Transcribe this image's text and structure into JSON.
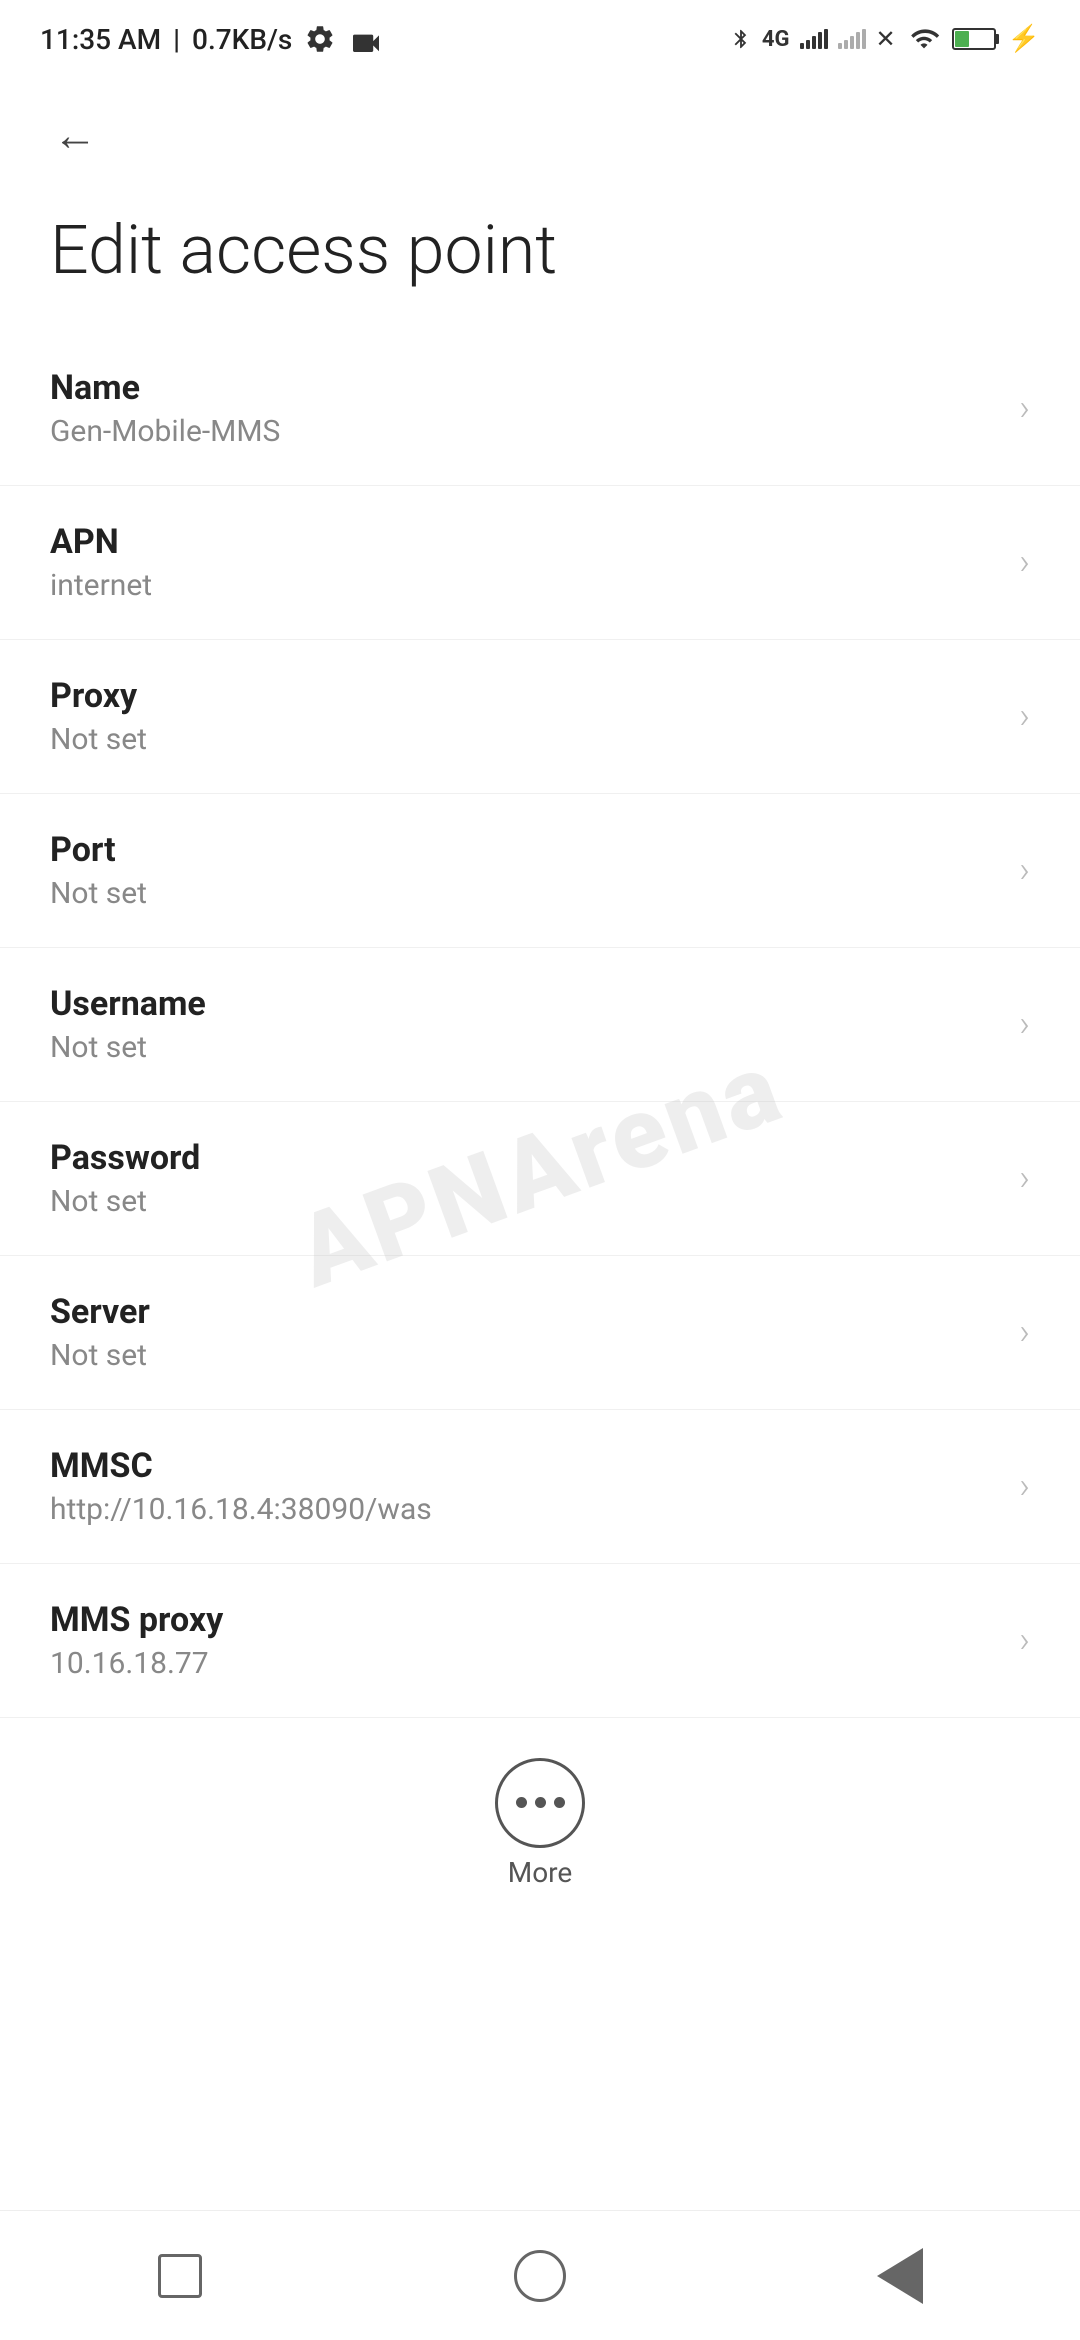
{
  "statusBar": {
    "time": "11:35 AM",
    "speed": "0.7KB/s",
    "battery": "38"
  },
  "toolbar": {
    "backLabel": "←"
  },
  "page": {
    "title": "Edit access point"
  },
  "settings": [
    {
      "id": "name",
      "label": "Name",
      "value": "Gen-Mobile-MMS"
    },
    {
      "id": "apn",
      "label": "APN",
      "value": "internet"
    },
    {
      "id": "proxy",
      "label": "Proxy",
      "value": "Not set"
    },
    {
      "id": "port",
      "label": "Port",
      "value": "Not set"
    },
    {
      "id": "username",
      "label": "Username",
      "value": "Not set"
    },
    {
      "id": "password",
      "label": "Password",
      "value": "Not set"
    },
    {
      "id": "server",
      "label": "Server",
      "value": "Not set"
    },
    {
      "id": "mmsc",
      "label": "MMSC",
      "value": "http://10.16.18.4:38090/was"
    },
    {
      "id": "mms-proxy",
      "label": "MMS proxy",
      "value": "10.16.18.77"
    }
  ],
  "more": {
    "label": "More"
  },
  "watermark": "APNArena"
}
